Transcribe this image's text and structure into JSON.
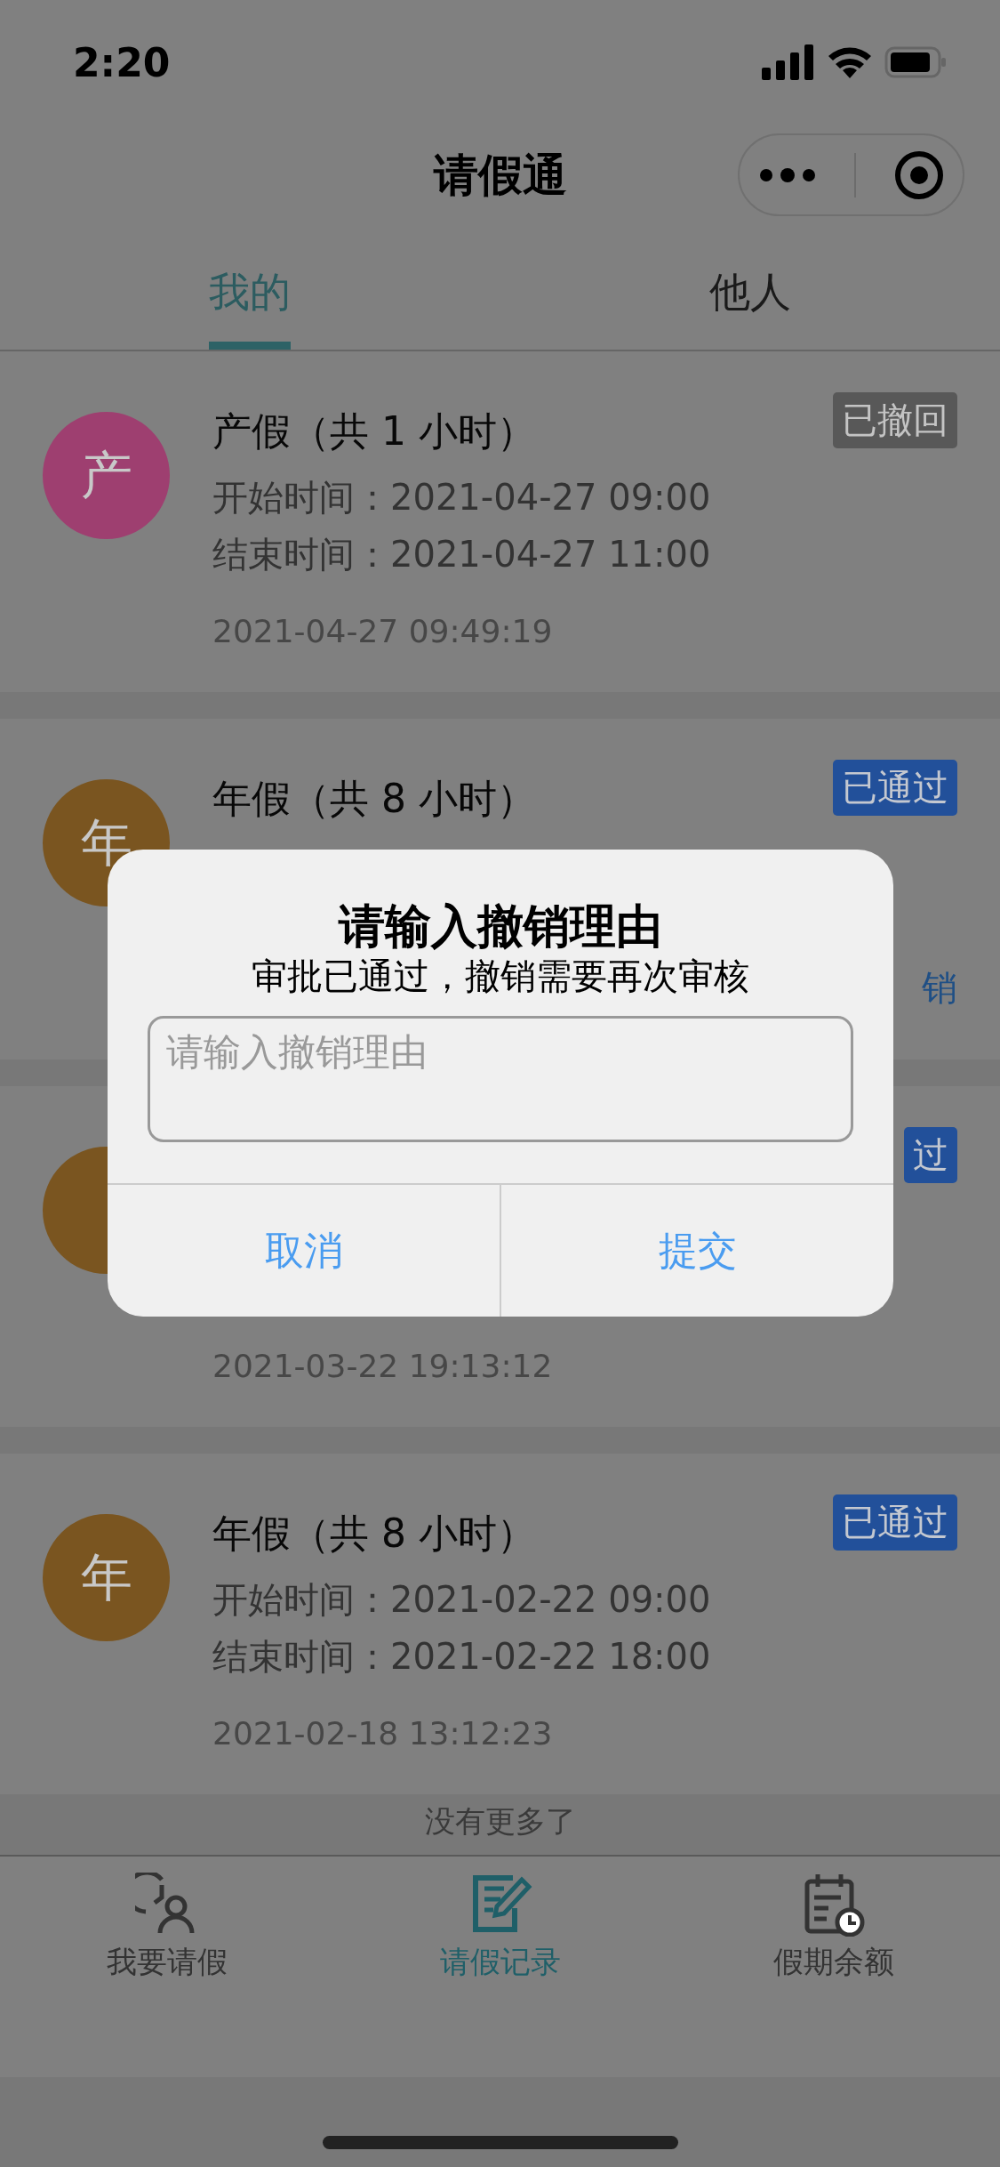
{
  "status_bar": {
    "time": "2:20"
  },
  "nav": {
    "title": "请假通"
  },
  "tabs": [
    {
      "label": "我的",
      "selected": true
    },
    {
      "label": "他人",
      "selected": false
    }
  ],
  "records": [
    {
      "avatar": "产",
      "color": "#9e3f70",
      "title": "产假（共 1 小时）",
      "status": "已撤回",
      "kind": "withdrawn",
      "lines": [
        "开始时间：2021-04-27 09:00",
        "结束时间：2021-04-27 11:00"
      ],
      "created": "2021-04-27 09:49:19"
    },
    {
      "avatar": "年",
      "color": "#7a5520",
      "title": "年假（共 8 小时）",
      "status": "已通过",
      "kind": "approved",
      "action": "销"
    },
    {
      "color": "#7a5520",
      "status": "过",
      "kind": "approved",
      "created": "2021-03-22 19:13:12"
    },
    {
      "avatar": "年",
      "color": "#7a5520",
      "title": "年假（共 8 小时）",
      "status": "已通过",
      "kind": "approved",
      "lines": [
        "开始时间：2021-02-22 09:00",
        "结束时间：2021-02-22 18:00"
      ],
      "created": "2021-02-18 13:12:23"
    }
  ],
  "list_footer": "没有更多了",
  "tab_bar": [
    {
      "label": "我要请假",
      "selected": false
    },
    {
      "label": "请假记录",
      "selected": true
    },
    {
      "label": "假期余额",
      "selected": false
    }
  ],
  "dialog": {
    "title": "请输入撤销理由",
    "message": "审批已通过，撤销需要再次审核",
    "input": {
      "placeholder": "请输入撤销理由"
    },
    "buttons": [
      "取消",
      "提交"
    ]
  }
}
